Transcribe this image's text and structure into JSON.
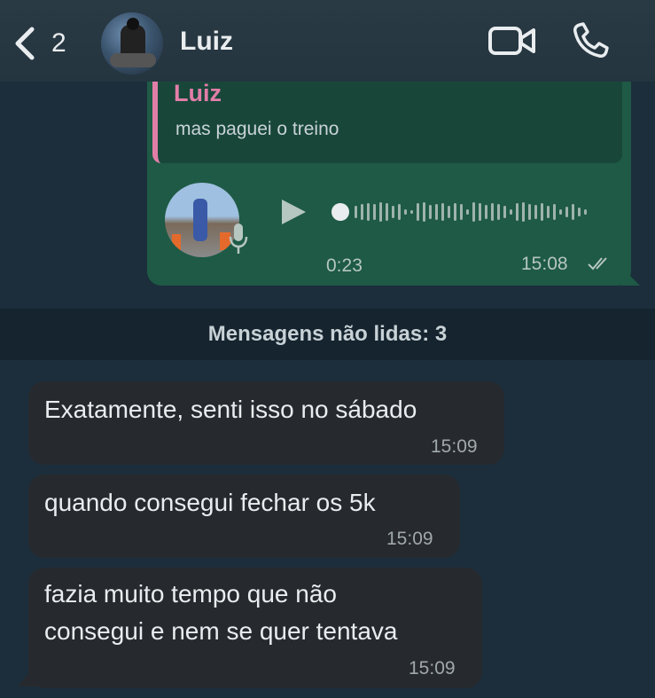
{
  "header": {
    "back_count": "2",
    "contact_name": "Luiz"
  },
  "voice_message": {
    "quote_author": "Luiz",
    "quote_text": "mas paguei o treino",
    "duration": "0:23",
    "time": "15:08",
    "status": "read"
  },
  "unread_divider": "Mensagens não lidas: 3",
  "messages": [
    {
      "text": "Exatamente, senti isso no sábado",
      "time": "15:09"
    },
    {
      "text": "quando consegui fechar os 5k",
      "time": "15:09"
    },
    {
      "line1": "fazia muito tempo que não",
      "line2": "consegui e nem se quer tentava",
      "time": "15:09"
    }
  ],
  "colors": {
    "background": "#1c2e3c",
    "outgoing_bubble": "#1e5a45",
    "incoming_bubble": "#262a2e",
    "quote_accent": "#e17ea8"
  },
  "icons": [
    "chevron-left-icon",
    "video-camera-icon",
    "phone-icon",
    "play-icon",
    "microphone-icon",
    "double-check-icon"
  ]
}
